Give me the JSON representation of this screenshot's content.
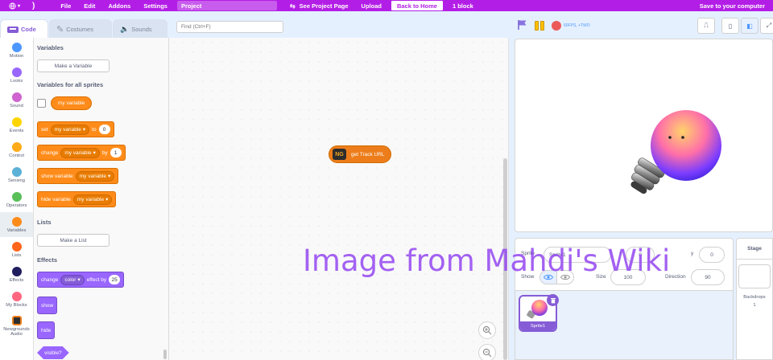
{
  "menu": {
    "items": [
      "File",
      "Edit",
      "Addons",
      "Settings"
    ],
    "project_title": "Project",
    "see_project_page": "See Project Page",
    "upload": "Upload",
    "back_to_home": "Back to Home",
    "block_count": "1 block",
    "save": "Save to your computer"
  },
  "tabs": {
    "code": "Code",
    "costumes": "Costumes",
    "sounds": "Sounds"
  },
  "categories": [
    {
      "label": "Motion",
      "color": "#4c97ff"
    },
    {
      "label": "Looks",
      "color": "#9966ff"
    },
    {
      "label": "Sound",
      "color": "#cf63cf"
    },
    {
      "label": "Events",
      "color": "#ffd500"
    },
    {
      "label": "Control",
      "color": "#ffab19"
    },
    {
      "label": "Sensing",
      "color": "#5cb1d6"
    },
    {
      "label": "Operators",
      "color": "#59c059"
    },
    {
      "label": "Variables",
      "color": "#ff8c1a"
    },
    {
      "label": "Lists",
      "color": "#ff661a"
    },
    {
      "label": "Effects",
      "color": "#1f1d5e"
    },
    {
      "label": "My Blocks",
      "color": "#ff6680"
    },
    {
      "label": "Newgrounds Audio",
      "color": "#ed7d1b"
    }
  ],
  "palette": {
    "variables_heading": "Variables",
    "make_variable": "Make a Variable",
    "all_sprites_heading": "Variables for all sprites",
    "my_variable": "my variable",
    "set_block": {
      "verb": "set",
      "var": "my variable",
      "to": "to",
      "value": "0"
    },
    "change_block": {
      "verb": "change",
      "var": "my variable",
      "by": "by",
      "value": "1"
    },
    "show_var_block": {
      "verb": "show variable",
      "var": "my variable"
    },
    "hide_var_block": {
      "verb": "hide variable",
      "var": "my variable"
    },
    "lists_heading": "Lists",
    "make_list": "Make a List",
    "effects_heading": "Effects",
    "effect_block": {
      "verb": "change",
      "effect": "color",
      "by": "effect by",
      "value": "25"
    },
    "show": "show",
    "hide": "hide",
    "visible": "visible?"
  },
  "search": {
    "placeholder": "Find (Ctrl+F)"
  },
  "workspace": {
    "ng_label": "NG",
    "block_text": "get Track URL"
  },
  "stage": {
    "fps": "60FPS, +TWO"
  },
  "sprite_info": {
    "sprite_label": "Sprite",
    "sprite_name": "Sprite1",
    "x_label": "x",
    "x_value": "0",
    "y_label": "y",
    "y_value": "0",
    "show_label": "Show",
    "size_label": "Size",
    "size_value": "100",
    "direction_label": "Direction",
    "direction_value": "90"
  },
  "sprites": [
    {
      "name": "Sprite1"
    }
  ],
  "stage_pane": {
    "title": "Stage",
    "backdrops_label": "Backdrops",
    "backdrops_count": "1"
  },
  "watermark": "Image from Mahdi's Wiki"
}
